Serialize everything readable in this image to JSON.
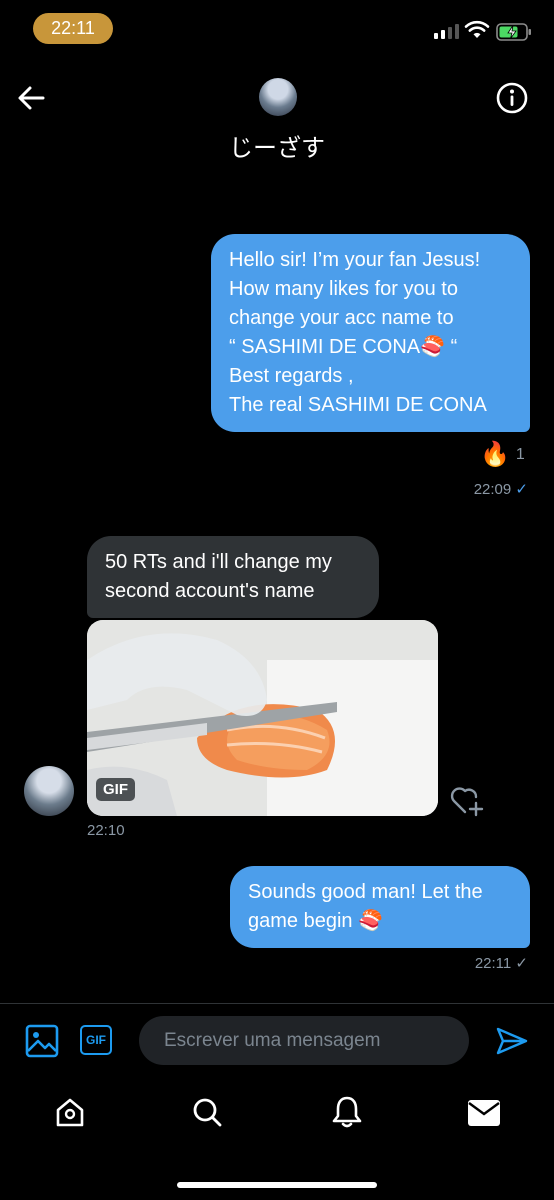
{
  "status_bar": {
    "time": "22:11",
    "battery_percent": 70,
    "signal_bars": 2
  },
  "header": {
    "name": "じーざす",
    "back_icon": "arrow-left-icon",
    "info_icon": "info-icon"
  },
  "messages": [
    {
      "direction": "outgoing",
      "lines": [
        "Hello sir! I’m your fan Jesus!",
        "How many likes for you to",
        "change your acc name to",
        "“ SASHIMI DE CONA🍣 “",
        "Best regards ,",
        "The real SASHIMI DE CONA"
      ],
      "reaction": {
        "emoji": "🔥",
        "count": "1"
      },
      "time": "22:09",
      "status": "✓"
    },
    {
      "direction": "incoming",
      "lines": [
        "50 RTs and i'll change my",
        "second account's name"
      ],
      "gif_badge": "GIF",
      "time": "22:10"
    },
    {
      "direction": "outgoing",
      "lines": [
        "Sounds good man! Let the",
        "game begin 🍣"
      ],
      "time": "22:11",
      "status": "✓"
    }
  ],
  "composer": {
    "placeholder": "Escrever uma mensagem",
    "gif_label": "GIF"
  },
  "colors": {
    "accent": "#1d9bf0",
    "outgoing_bubble": "#4c9eeb",
    "incoming_bubble": "#2f3336"
  },
  "tab_bar": [
    "home-icon",
    "search-icon",
    "notifications-icon",
    "messages-icon"
  ]
}
